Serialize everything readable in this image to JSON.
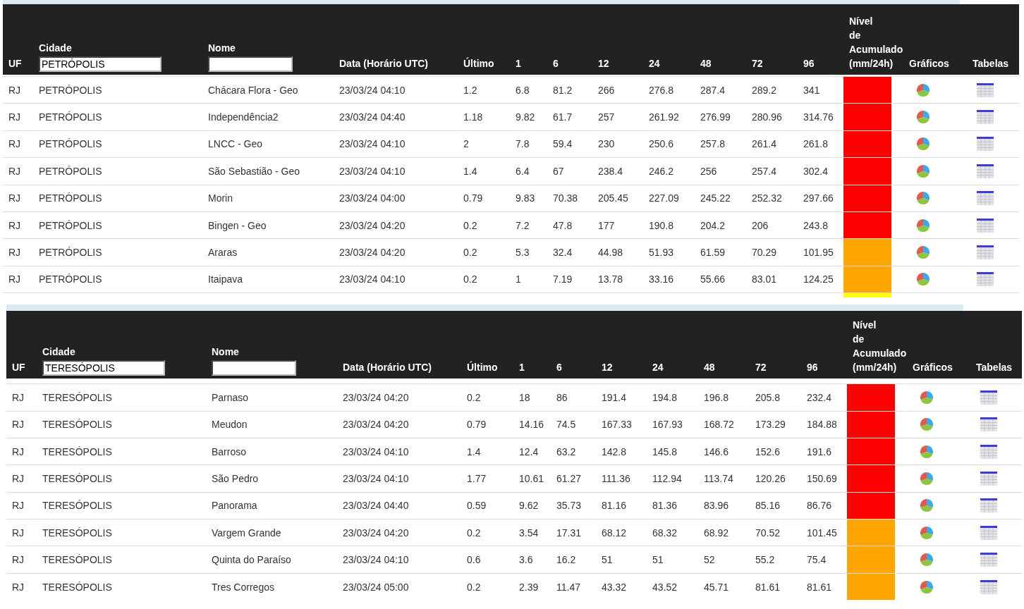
{
  "tables": [
    {
      "columns": [
        {
          "kind": "text",
          "label": "UF"
        },
        {
          "kind": "filter",
          "label": "Cidade",
          "value": "PETRÓPOLIS"
        },
        {
          "kind": "filter",
          "label": "Nome"
        },
        {
          "kind": "text",
          "label": "Data (Horário UTC)"
        },
        {
          "kind": "text",
          "label": "Último"
        },
        {
          "kind": "text",
          "label": "1"
        },
        {
          "kind": "text",
          "label": "6"
        },
        {
          "kind": "text",
          "label": "12"
        },
        {
          "kind": "text",
          "label": "24"
        },
        {
          "kind": "text",
          "label": "48"
        },
        {
          "kind": "text",
          "label": "72"
        },
        {
          "kind": "text",
          "label": "96"
        },
        {
          "kind": "lines",
          "lines": [
            "Nível",
            "de",
            "Acumulado",
            "(mm/24h)"
          ]
        },
        {
          "kind": "text",
          "label": "Gráficos"
        },
        {
          "kind": "text",
          "label": "Tabelas"
        }
      ],
      "rows": [
        {
          "cells": [
            "RJ",
            "PETRÓPOLIS",
            "Chácara Flora - Geo",
            "23/03/24 04:10",
            "1.2",
            "6.8",
            "81.2",
            "266",
            "276.8",
            "287.4",
            "289.2",
            "341"
          ],
          "color": "#ff0000"
        },
        {
          "cells": [
            "RJ",
            "PETRÓPOLIS",
            "Independência2",
            "23/03/24 04:40",
            "1.18",
            "9.82",
            "61.7",
            "257",
            "261.92",
            "276.99",
            "280.96",
            "314.76"
          ],
          "color": "#ff0000"
        },
        {
          "cells": [
            "RJ",
            "PETRÓPOLIS",
            "LNCC - Geo",
            "23/03/24 04:10",
            "2",
            "7.8",
            "59.4",
            "230",
            "250.6",
            "257.8",
            "261.4",
            "261.8"
          ],
          "color": "#ff0000"
        },
        {
          "cells": [
            "RJ",
            "PETRÓPOLIS",
            "São Sebastião - Geo",
            "23/03/24 04:10",
            "1.4",
            "6.4",
            "67",
            "238.4",
            "246.2",
            "256",
            "257.4",
            "302.4"
          ],
          "color": "#ff0000"
        },
        {
          "cells": [
            "RJ",
            "PETRÓPOLIS",
            "Morin",
            "23/03/24 04:00",
            "0.79",
            "9.83",
            "70.38",
            "205.45",
            "227.09",
            "245.22",
            "252.32",
            "297.66"
          ],
          "color": "#ff0000"
        },
        {
          "cells": [
            "RJ",
            "PETRÓPOLIS",
            "Bingen - Geo",
            "23/03/24 04:20",
            "0.2",
            "7.2",
            "47.8",
            "177",
            "190.8",
            "204.2",
            "206",
            "243.8"
          ],
          "color": "#ff0000"
        },
        {
          "cells": [
            "RJ",
            "PETRÓPOLIS",
            "Araras",
            "23/03/24 04:20",
            "0.2",
            "5.3",
            "32.4",
            "44.98",
            "51.93",
            "61.59",
            "70.29",
            "101.95"
          ],
          "color": "#ffa500"
        },
        {
          "cells": [
            "RJ",
            "PETRÓPOLIS",
            "Itaipava",
            "23/03/24 04:10",
            "0.2",
            "1",
            "7.19",
            "13.78",
            "33.16",
            "55.66",
            "83.01",
            "124.25"
          ],
          "color": "#ffa500"
        }
      ],
      "footer_bar": {
        "color": "#ffff00"
      }
    },
    {
      "columns": [
        {
          "kind": "text",
          "label": "UF"
        },
        {
          "kind": "filter",
          "label": "Cidade",
          "value": "TERESÓPOLIS"
        },
        {
          "kind": "filter",
          "label": "Nome"
        },
        {
          "kind": "text",
          "label": "Data (Horário UTC)"
        },
        {
          "kind": "text",
          "label": "Último"
        },
        {
          "kind": "text",
          "label": "1"
        },
        {
          "kind": "text",
          "label": "6"
        },
        {
          "kind": "text",
          "label": "12"
        },
        {
          "kind": "text",
          "label": "24"
        },
        {
          "kind": "text",
          "label": "48"
        },
        {
          "kind": "text",
          "label": "72"
        },
        {
          "kind": "text",
          "label": "96"
        },
        {
          "kind": "lines",
          "lines": [
            "Nível",
            "de",
            "Acumulado",
            "(mm/24h)"
          ]
        },
        {
          "kind": "text",
          "label": "Gráficos"
        },
        {
          "kind": "text",
          "label": "Tabelas"
        }
      ],
      "rows": [
        {
          "cells": [
            "RJ",
            "TERESÓPOLIS",
            "Parnaso",
            "23/03/24 04:20",
            "0.2",
            "18",
            "86",
            "191.4",
            "194.8",
            "196.8",
            "205.8",
            "232.4"
          ],
          "color": "#ff0000"
        },
        {
          "cells": [
            "RJ",
            "TERESÓPOLIS",
            "Meudon",
            "23/03/24 04:20",
            "0.79",
            "14.16",
            "74.5",
            "167.33",
            "167.93",
            "168.72",
            "173.29",
            "184.88"
          ],
          "color": "#ff0000"
        },
        {
          "cells": [
            "RJ",
            "TERESÓPOLIS",
            "Barroso",
            "23/03/24 04:10",
            "1.4",
            "12.4",
            "63.2",
            "142.8",
            "145.8",
            "146.6",
            "152.6",
            "191.6"
          ],
          "color": "#ff0000"
        },
        {
          "cells": [
            "RJ",
            "TERESÓPOLIS",
            "São Pedro",
            "23/03/24 04:10",
            "1.77",
            "10.61",
            "61.27",
            "111.36",
            "112.94",
            "113.74",
            "120.26",
            "150.69"
          ],
          "color": "#ff0000"
        },
        {
          "cells": [
            "RJ",
            "TERESÓPOLIS",
            "Panorama",
            "23/03/24 04:40",
            "0.59",
            "9.62",
            "35.73",
            "81.16",
            "81.36",
            "83.96",
            "85.16",
            "86.76"
          ],
          "color": "#ff0000"
        },
        {
          "cells": [
            "RJ",
            "TERESÓPOLIS",
            "Vargem Grande",
            "23/03/24 04:20",
            "0.2",
            "3.54",
            "17.31",
            "68.12",
            "68.32",
            "68.92",
            "70.52",
            "101.45"
          ],
          "color": "#ffa500"
        },
        {
          "cells": [
            "RJ",
            "TERESÓPOLIS",
            "Quinta do Paraíso",
            "23/03/24 04:10",
            "0.6",
            "3.6",
            "16.2",
            "51",
            "51",
            "52",
            "55.2",
            "75.4"
          ],
          "color": "#ffa500"
        },
        {
          "cells": [
            "RJ",
            "TERESÓPOLIS",
            "Tres Corregos",
            "23/03/24 05:00",
            "0.2",
            "2.39",
            "11.47",
            "43.32",
            "43.52",
            "45.71",
            "81.61",
            "81.61"
          ],
          "color": "#ffa500"
        }
      ]
    }
  ]
}
